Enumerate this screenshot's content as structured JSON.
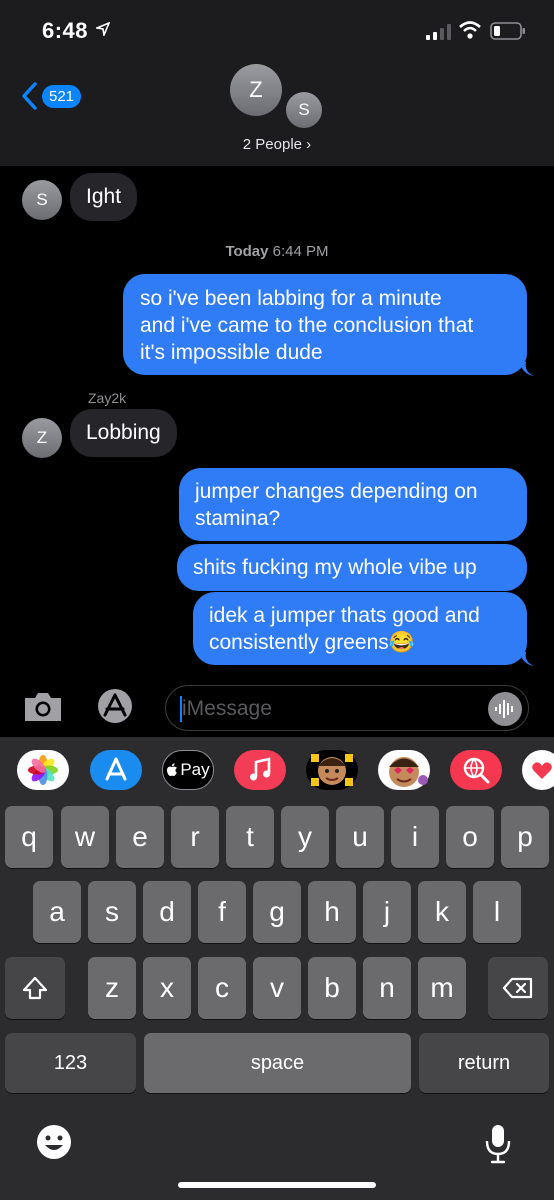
{
  "status": {
    "time": "6:48"
  },
  "header": {
    "back_count": "521",
    "avatar_big": "Z",
    "avatar_small": "S",
    "people_label": "2 People ›"
  },
  "conversation": {
    "msg1": {
      "avatar": "S",
      "text": "Ight"
    },
    "timestamp": {
      "day": "Today",
      "time": "6:44 PM"
    },
    "msg2": {
      "lines": [
        "so i've been labbing for a minute",
        "and i've came to the conclusion that",
        "it's impossible dude"
      ]
    },
    "sender2": "Zay2k",
    "msg3": {
      "avatar": "Z",
      "text": "Lobbing"
    },
    "msg4": {
      "lines": [
        "jumper changes depending on",
        "stamina?"
      ]
    },
    "msg5": {
      "text": "shits fucking my whole vibe up"
    },
    "msg6": {
      "lines": [
        "idek a jumper thats good and",
        "consistently greens😂"
      ]
    }
  },
  "input": {
    "placeholder": "iMessage"
  },
  "apps": {
    "pay_label": "Pay",
    "items": [
      "photos-app-icon",
      "app-store-icon",
      "apple-pay-icon",
      "music-icon",
      "memoji-icon",
      "memoji-stickers-icon",
      "web-images-icon",
      "digital-touch-icon"
    ]
  },
  "keyboard": {
    "row1": [
      "q",
      "w",
      "e",
      "r",
      "t",
      "y",
      "u",
      "i",
      "o",
      "p"
    ],
    "row2": [
      "a",
      "s",
      "d",
      "f",
      "g",
      "h",
      "j",
      "k",
      "l"
    ],
    "row3": [
      "z",
      "x",
      "c",
      "v",
      "b",
      "n",
      "m"
    ],
    "numbers_label": "123",
    "space_label": "space",
    "return_label": "return"
  },
  "colors": {
    "outgoing": "#2f7cf6",
    "incoming": "#26252a",
    "accent": "#0a84ff"
  }
}
